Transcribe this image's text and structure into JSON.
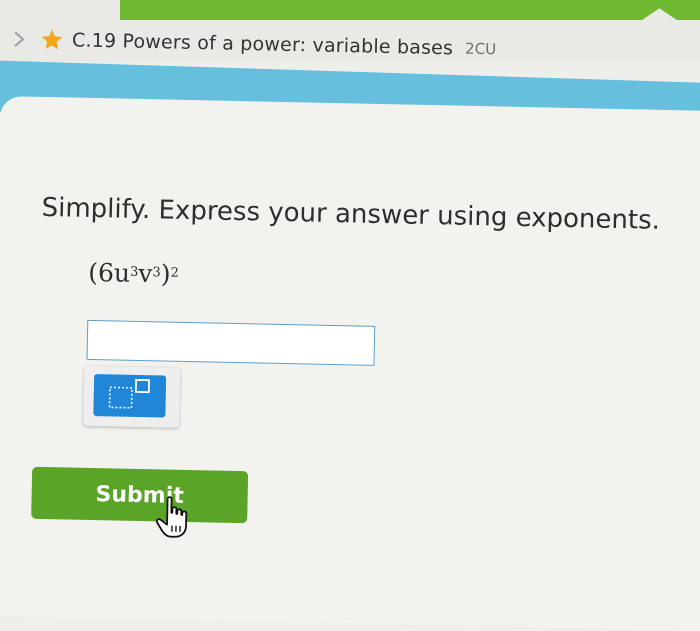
{
  "header": {
    "chevron_icon": "chevron-right-icon",
    "star_icon": "star-icon",
    "star_color": "#f2a71d",
    "skill_title": "C.19 Powers of a power: variable bases",
    "skill_code": "2CU",
    "accent_green": "#6eb92f",
    "accent_blue": "#65bfdd"
  },
  "question": {
    "instruction": "Simplify. Express your answer using exponents.",
    "expression": {
      "open": "(6u",
      "u_exp": "3",
      "v": "v",
      "v_exp": "3",
      "close": ")",
      "outer_exp": "2"
    }
  },
  "answer": {
    "value": "",
    "placeholder": ""
  },
  "keypad": {
    "exponent_icon": "exponent-template-icon"
  },
  "submit": {
    "label": "Submit",
    "color": "#5aa428"
  },
  "cursor_icon": "hand-pointer-icon"
}
